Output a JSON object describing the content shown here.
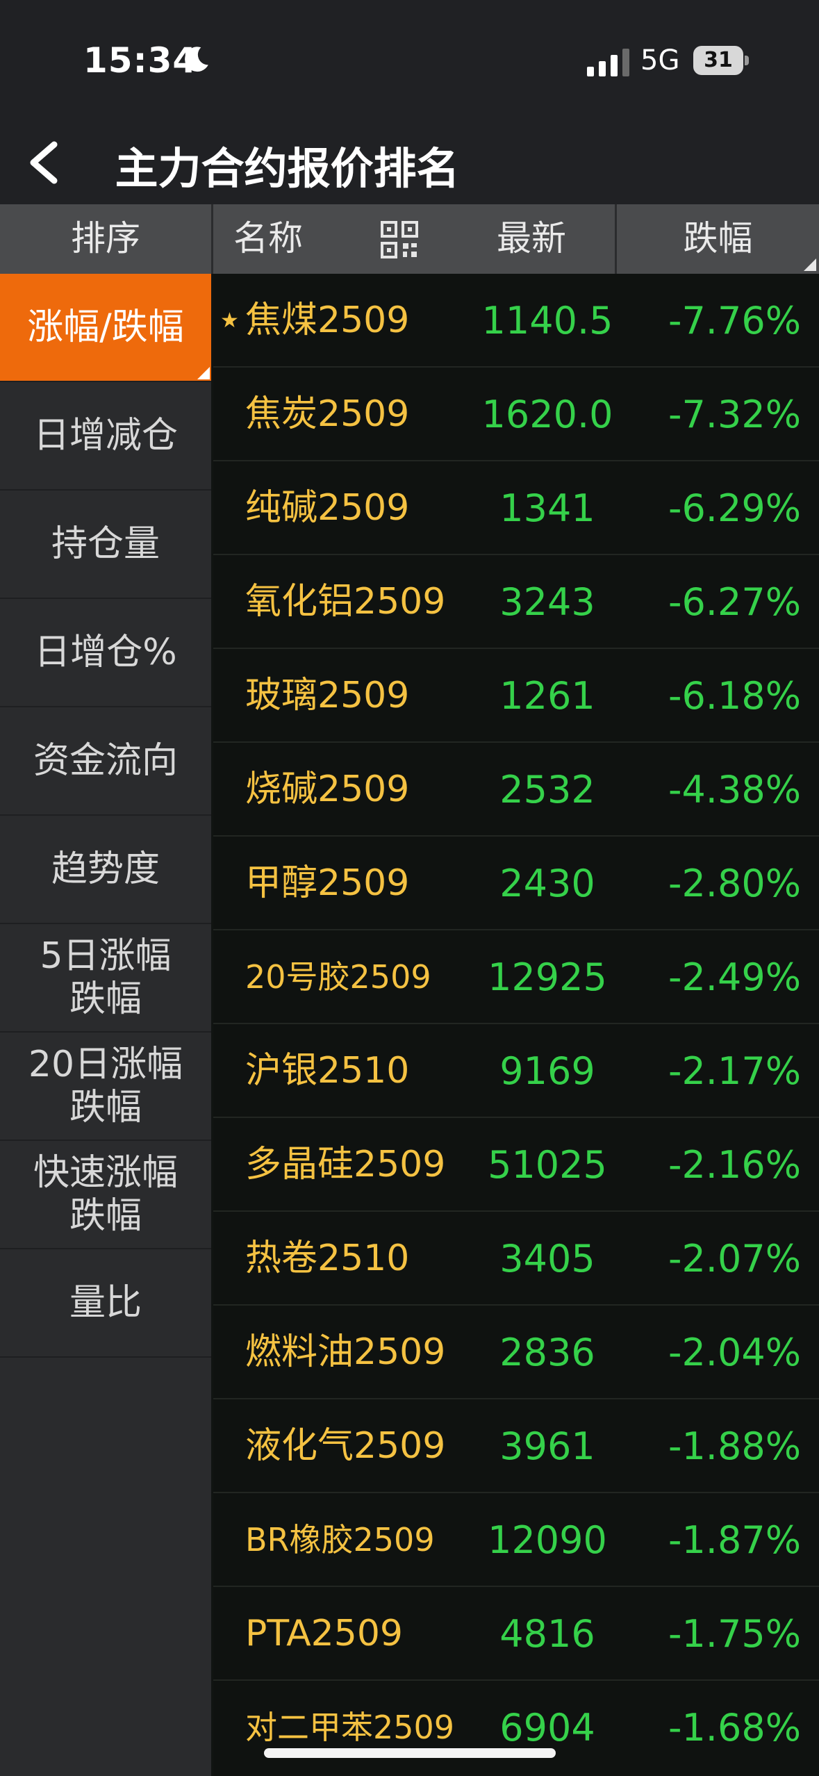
{
  "status_bar": {
    "time": "15:34",
    "network": "5G",
    "battery": "31"
  },
  "nav": {
    "title": "主力合约报价排名"
  },
  "header": {
    "sort": "排序",
    "name": "名称",
    "last": "最新",
    "change": "跌幅"
  },
  "sidebar": {
    "items": [
      {
        "label": "涨幅/跌幅",
        "active": true
      },
      {
        "label": "日增减仓"
      },
      {
        "label": "持仓量"
      },
      {
        "label": "日增仓%"
      },
      {
        "label": "资金流向"
      },
      {
        "label": "趋势度"
      },
      {
        "label": "5日涨幅\n跌幅"
      },
      {
        "label": "20日涨幅\n跌幅"
      },
      {
        "label": "快速涨幅\n跌幅"
      },
      {
        "label": "量比"
      }
    ]
  },
  "rows": [
    {
      "name": "焦煤2509",
      "last": "1140.5",
      "change": "-7.76%",
      "starred": true
    },
    {
      "name": "焦炭2509",
      "last": "1620.0",
      "change": "-7.32%"
    },
    {
      "name": "纯碱2509",
      "last": "1341",
      "change": "-6.29%"
    },
    {
      "name": "氧化铝2509",
      "last": "3243",
      "change": "-6.27%"
    },
    {
      "name": "玻璃2509",
      "last": "1261",
      "change": "-6.18%"
    },
    {
      "name": "烧碱2509",
      "last": "2532",
      "change": "-4.38%"
    },
    {
      "name": "甲醇2509",
      "last": "2430",
      "change": "-2.80%"
    },
    {
      "name": "20号胶2509",
      "last": "12925",
      "change": "-2.49%"
    },
    {
      "name": "沪银2510",
      "last": "9169",
      "change": "-2.17%"
    },
    {
      "name": "多晶硅2509",
      "last": "51025",
      "change": "-2.16%"
    },
    {
      "name": "热卷2510",
      "last": "3405",
      "change": "-2.07%"
    },
    {
      "name": "燃料油2509",
      "last": "2836",
      "change": "-2.04%"
    },
    {
      "name": "液化气2509",
      "last": "3961",
      "change": "-1.88%"
    },
    {
      "name": "BR橡胶2509",
      "last": "12090",
      "change": "-1.87%"
    },
    {
      "name": "PTA2509",
      "last": "4816",
      "change": "-1.75%"
    },
    {
      "name": "对二甲苯2509",
      "last": "6904",
      "change": "-1.68%"
    }
  ],
  "colors": {
    "active_tab": "#ee6a0c",
    "name_text": "#f5c242",
    "down_green": "#35d14a"
  }
}
